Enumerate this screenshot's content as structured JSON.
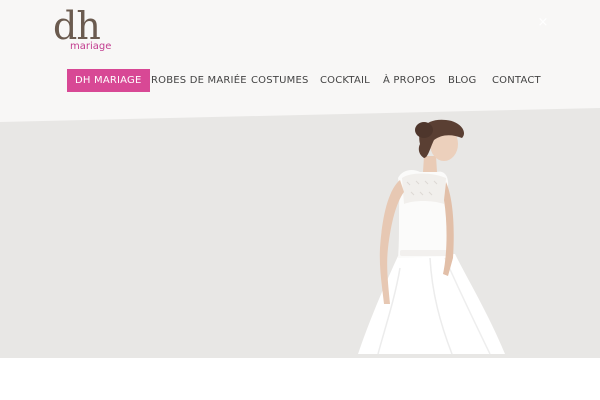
{
  "logo": {
    "main": "dh",
    "sub": "mariage"
  },
  "nav": {
    "items": [
      {
        "label": "DH MARIAGE",
        "active": true
      },
      {
        "label": "ROBES DE MARIÉE",
        "active": false
      },
      {
        "label": "COSTUMES",
        "active": false
      },
      {
        "label": "COCKTAIL",
        "active": false
      },
      {
        "label": "À PROPOS",
        "active": false
      },
      {
        "label": "BLOG",
        "active": false
      },
      {
        "label": "CONTACT",
        "active": false
      }
    ]
  },
  "hero": {
    "image": "bride-in-white-lace-dress"
  },
  "colors": {
    "accent": "#d84895",
    "logo": "#6b5b4f",
    "logo_sub": "#c23d8f",
    "hero_bg": "#e8e7e5"
  }
}
